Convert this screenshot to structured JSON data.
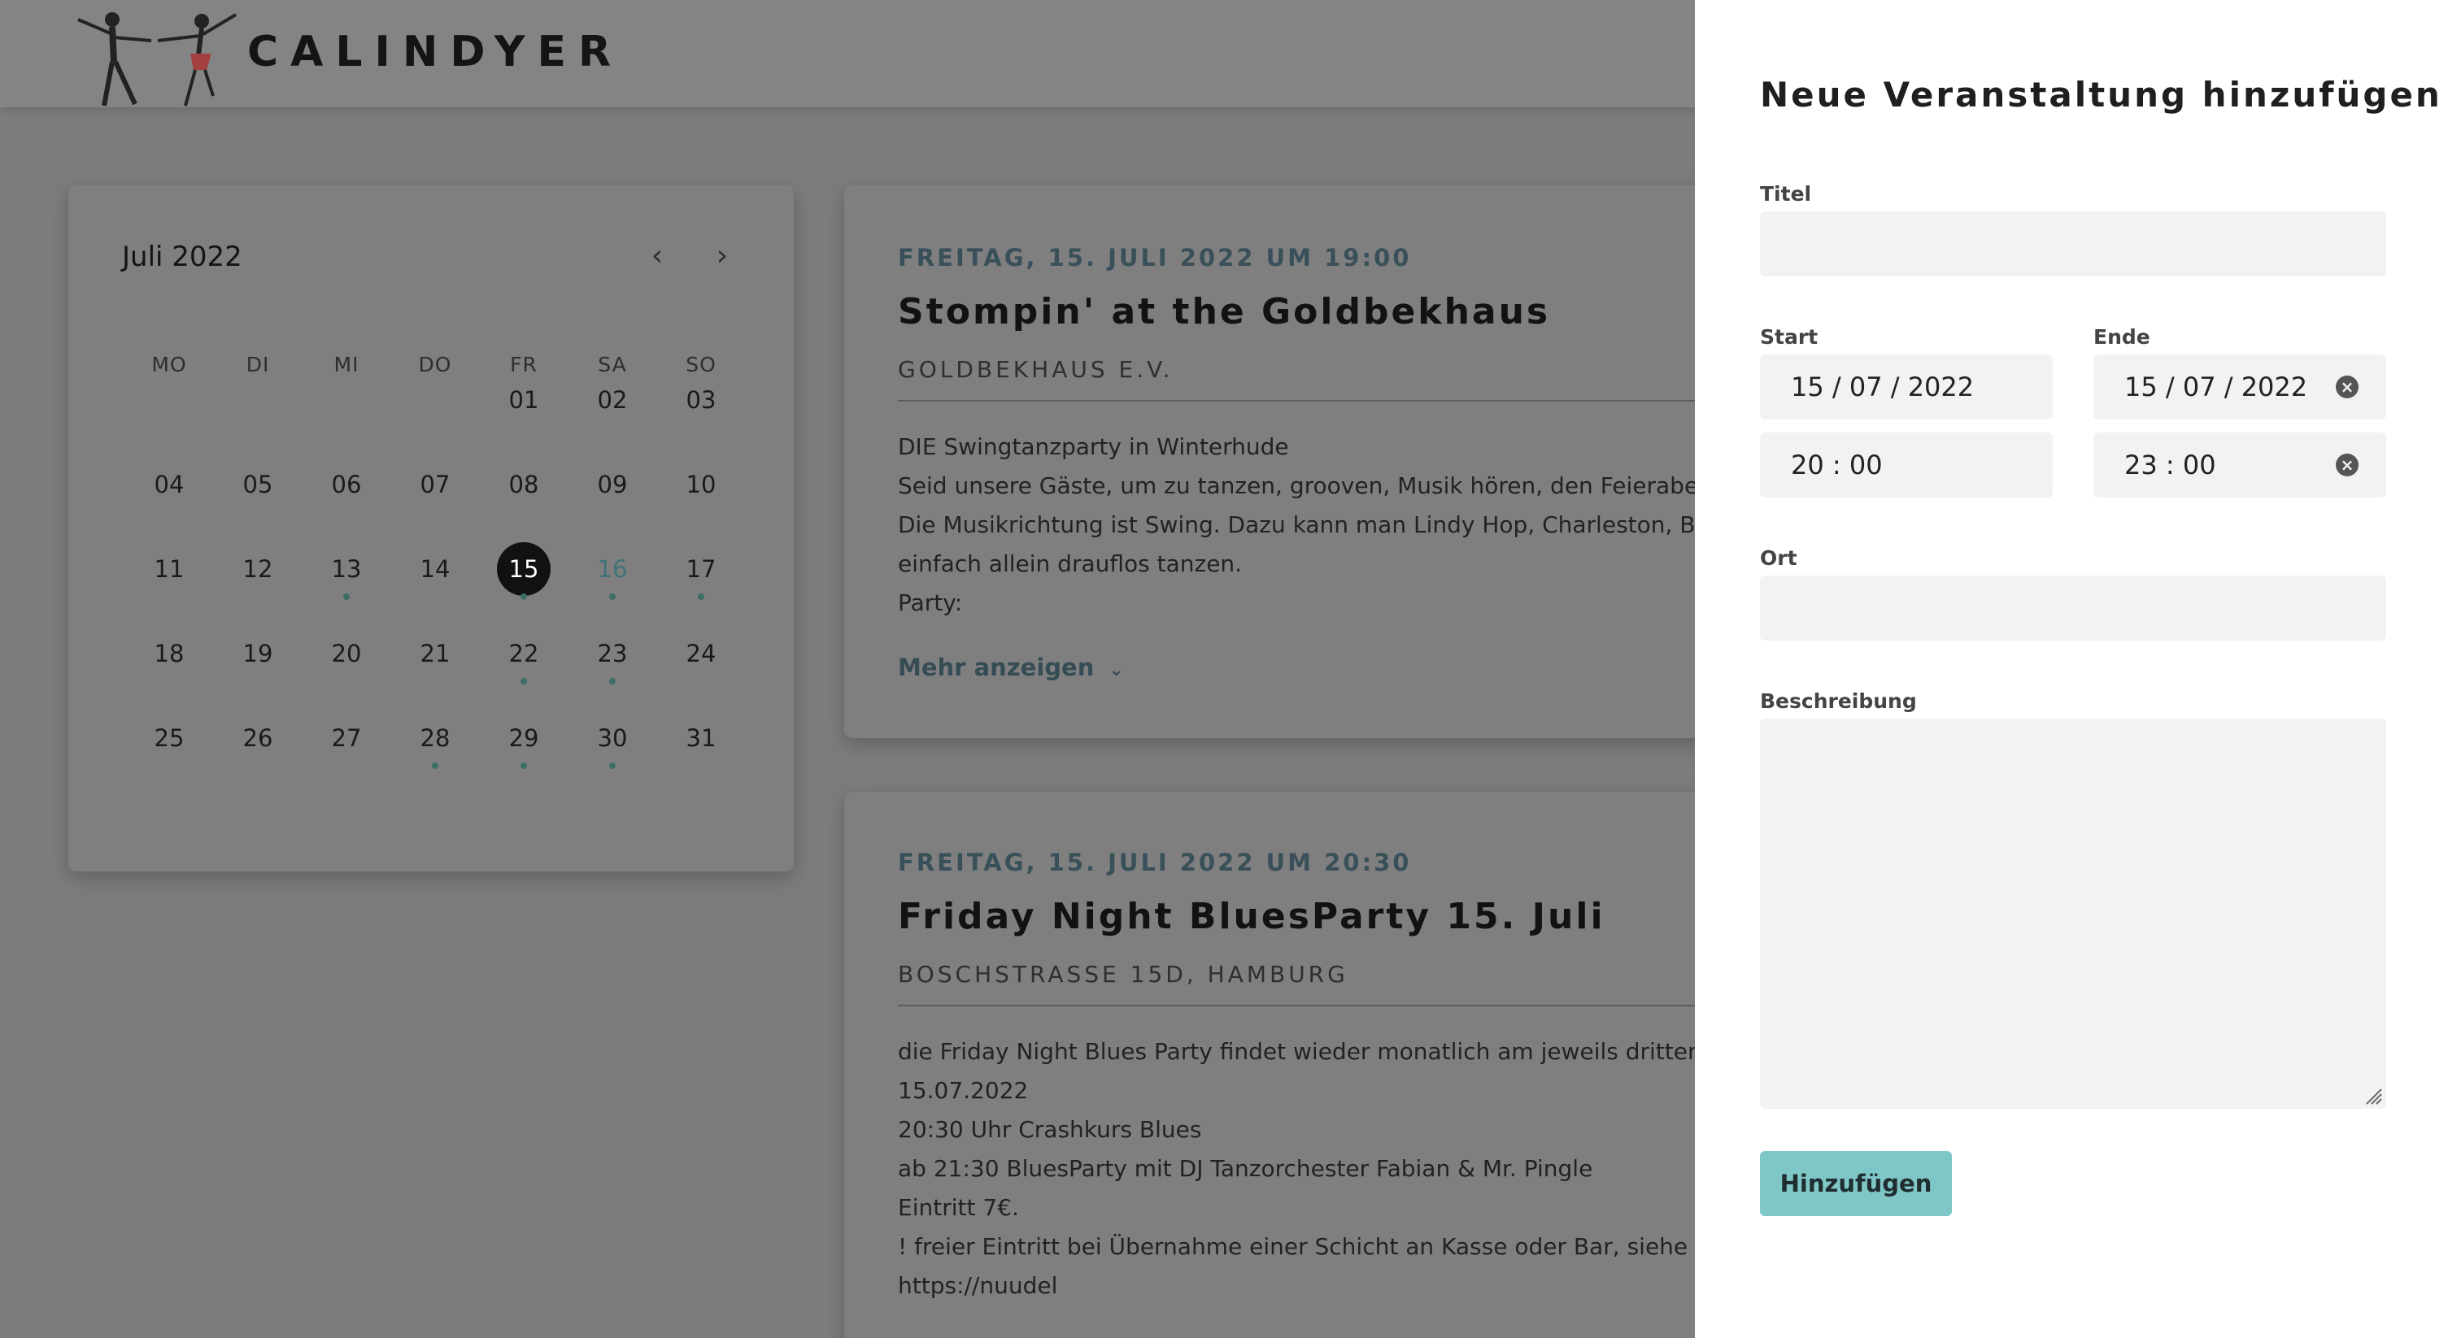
{
  "header": {
    "brand": "CALINDYER"
  },
  "calendar": {
    "month": "Juli 2022",
    "weekdays": [
      "MO",
      "DI",
      "MI",
      "DO",
      "FR",
      "SA",
      "SO"
    ],
    "rows": [
      [
        "",
        "",
        "",
        "",
        "01",
        "02",
        "03"
      ],
      [
        "04",
        "05",
        "06",
        "07",
        "08",
        "09",
        "10"
      ],
      [
        "11",
        "12",
        "13",
        "14",
        "15",
        "16",
        "17"
      ],
      [
        "18",
        "19",
        "20",
        "21",
        "22",
        "23",
        "24"
      ],
      [
        "25",
        "26",
        "27",
        "28",
        "29",
        "30",
        "31"
      ]
    ],
    "selected": "15",
    "today": "16",
    "event_days": [
      "13",
      "15",
      "16",
      "17",
      "22",
      "23",
      "28",
      "29",
      "30"
    ]
  },
  "events": [
    {
      "date": "FREITAG, 15. JULI 2022 UM 19:00",
      "title": "Stompin' at the Goldbekhaus",
      "location": "GOLDBEKHAUS E.V.",
      "lines": [
        "DIE Swingtanzparty in Winterhude",
        "Seid unsere Gäste, um zu tanzen, grooven, Musik hören, den Feierabend",
        "Die Musikrichtung ist Swing. Dazu kann man Lindy Hop, Charleston, Bal",
        "einfach allein drauflos tanzen.",
        "Party:"
      ],
      "more": "Mehr anzeigen"
    },
    {
      "date": "FREITAG, 15. JULI 2022 UM 20:30",
      "title": "Friday Night BluesParty 15. Juli",
      "location": "BOSCHSTRASSE 15D, HAMBURG",
      "lines": [
        "die Friday Night Blues Party findet wieder monatlich am jeweils dritten",
        "15.07.2022",
        "20:30 Uhr Crashkurs Blues",
        "ab 21:30 BluesParty mit DJ Tanzorchester Fabian & Mr. Pingle",
        "Eintritt 7€.",
        "! freier Eintritt bei Übernahme einer Schicht an Kasse oder Bar, siehe h",
        "https://nuudel"
      ]
    }
  ],
  "panel": {
    "title": "Neue Veranstaltung hinzufügen",
    "title_label": "Titel",
    "start_label": "Start",
    "end_label": "Ende",
    "start_date": "15 / 07 / 2022",
    "start_time": "20 : 00",
    "end_date": "15 / 07 / 2022",
    "end_time": "23 : 00",
    "location_label": "Ort",
    "description_label": "Beschreibung",
    "submit": "Hinzufügen"
  },
  "colors": {
    "accent": "#7fc7c6",
    "overlay": "#7c7c7c",
    "selected_day": "#111111",
    "event_dot": "#3c6e66"
  }
}
